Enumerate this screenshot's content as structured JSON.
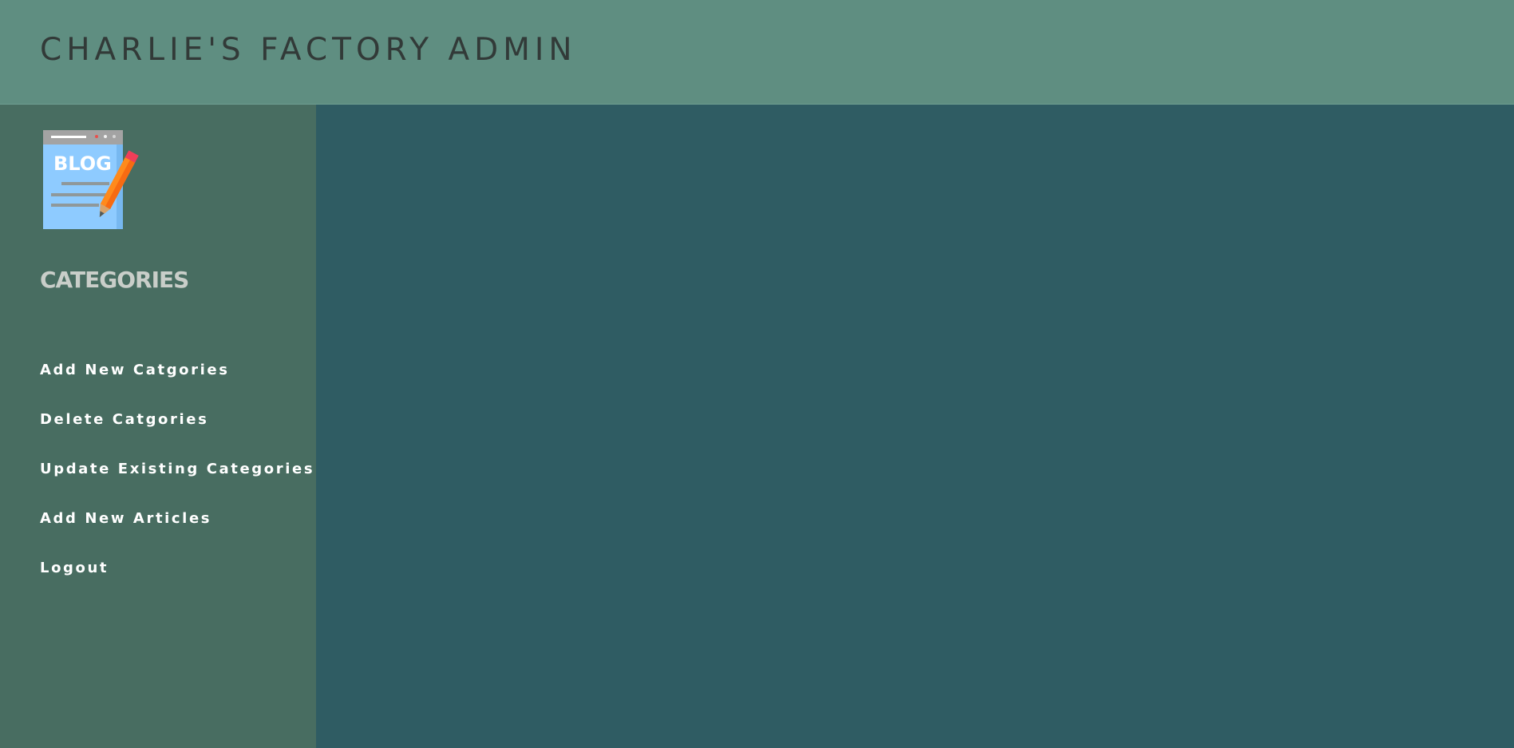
{
  "header": {
    "title": "CHARLIE'S FACTORY ADMIN",
    "background_color": "#5f8e81",
    "title_color": "#323a38"
  },
  "sidebar": {
    "background_color": "#486d61",
    "logo": {
      "icon": "blog-notepad-pencil-icon",
      "text": "BLOG"
    },
    "heading": "CATEGORIES",
    "items": [
      {
        "label": "Add New Catgories"
      },
      {
        "label": "Delete Catgories"
      },
      {
        "label": "Update Existing Categories"
      },
      {
        "label": "Add New Articles"
      },
      {
        "label": "Logout"
      }
    ]
  },
  "main": {
    "background_color": "#2f5c63"
  }
}
